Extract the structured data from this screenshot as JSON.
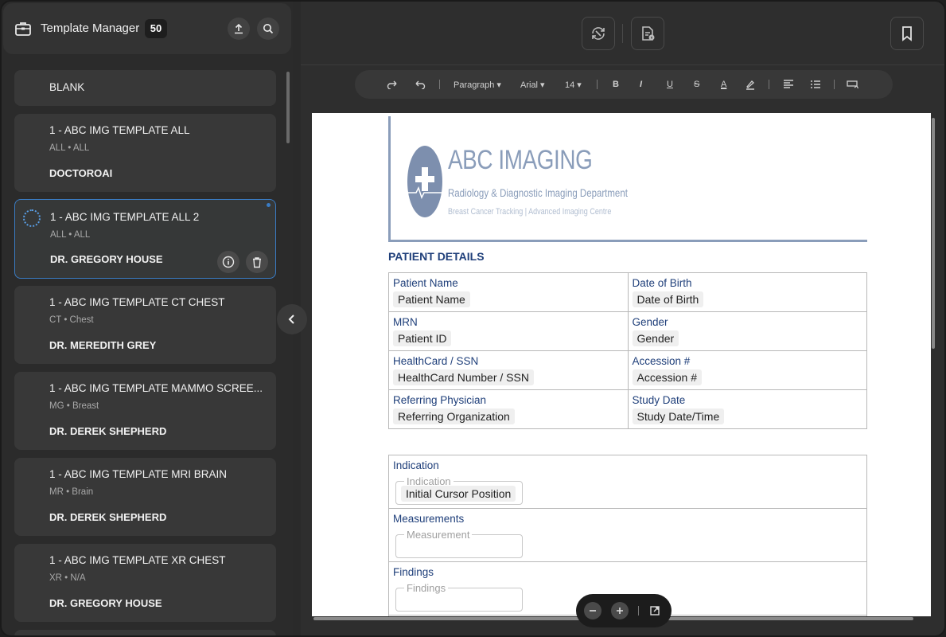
{
  "sidebar": {
    "title": "Template Manager",
    "count": "50",
    "templates": [
      {
        "name": "BLANK",
        "meta": "",
        "doctor": ""
      },
      {
        "name": "1 - ABC IMG TEMPLATE ALL",
        "meta": "ALL • ALL",
        "doctor": "DOCTOROAI"
      },
      {
        "name": "1 - ABC IMG TEMPLATE ALL 2",
        "meta": "ALL • ALL",
        "doctor": "DR. GREGORY HOUSE"
      },
      {
        "name": "1 - ABC IMG TEMPLATE CT CHEST",
        "meta": "CT • Chest",
        "doctor": "DR. MEREDITH GREY"
      },
      {
        "name": "1 - ABC IMG TEMPLATE MAMMO SCREE...",
        "meta": "MG • Breast",
        "doctor": "DR. DEREK SHEPHERD"
      },
      {
        "name": "1 - ABC IMG TEMPLATE MRI BRAIN",
        "meta": "MR • Brain",
        "doctor": "DR. DEREK SHEPHERD"
      },
      {
        "name": "1 - ABC IMG TEMPLATE XR CHEST",
        "meta": "XR • N/A",
        "doctor": "DR. GREGORY HOUSE"
      }
    ]
  },
  "toolbar": {
    "block_type": "Paragraph ▾",
    "font": "Arial ▾",
    "size": "14 ▾",
    "bold": "B",
    "italic": "I",
    "underline": "U",
    "strike": "S",
    "font_color": "A"
  },
  "document": {
    "logo_title": "ABC IMAGING",
    "logo_subtitle": "Radiology & Diagnostic Imaging Department",
    "logo_tagline": "Breast Cancer Tracking | Advanced Imaging Centre",
    "section_title": "PATIENT DETAILS",
    "fields": [
      {
        "label": "Patient Name",
        "value": "Patient Name"
      },
      {
        "label": "Date of Birth",
        "value": "Date of Birth"
      },
      {
        "label": "MRN",
        "value": "Patient ID"
      },
      {
        "label": "Gender",
        "value": "Gender"
      },
      {
        "label": "HealthCard / SSN",
        "value": "HealthCard Number / SSN"
      },
      {
        "label": "Accession #",
        "value": "Accession #"
      },
      {
        "label": "Referring Physician",
        "value": "Referring Organization"
      },
      {
        "label": "Study Date",
        "value": "Study Date/Time"
      }
    ],
    "report": [
      {
        "label": "Indication",
        "legend": "Indication",
        "value": "Initial Cursor Position"
      },
      {
        "label": "Measurements",
        "legend": "Measurement",
        "value": ""
      },
      {
        "label": "Findings",
        "legend": "Findings",
        "value": ""
      }
    ]
  },
  "colors": {
    "accent": "#3a7cc4",
    "label_blue": "#1f3f7a",
    "logo": "#8a9dba"
  }
}
